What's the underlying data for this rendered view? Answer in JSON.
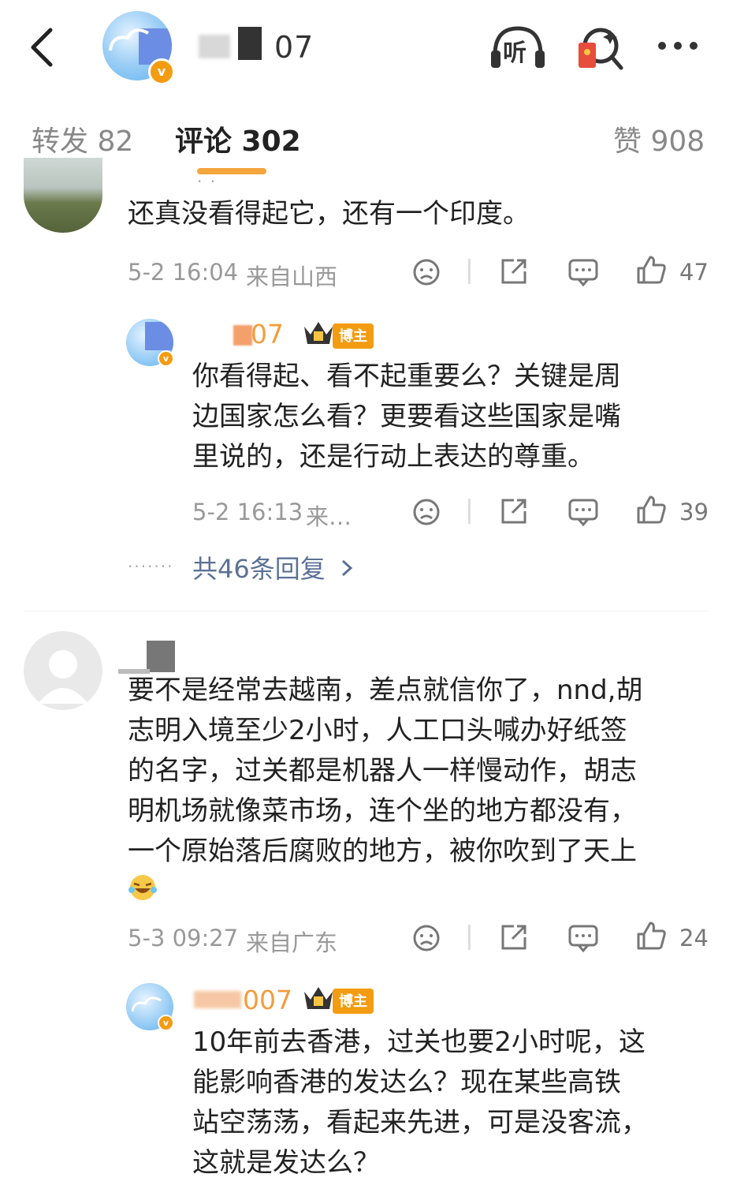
{
  "header": {
    "name_visible": "07",
    "listen_label": "听"
  },
  "tabs": [
    {
      "label": "转发 82"
    },
    {
      "label": "评论 302"
    },
    {
      "label": "赞 908"
    }
  ],
  "comments": [
    {
      "text": "还真没看得起它，还有一个印度。",
      "time": "5-2 16:04",
      "location": "来自山西",
      "likes": "47",
      "reply": {
        "name": "07",
        "badge": "博主",
        "text_lines": [
          "你看得起、看不起重要么？关键是周",
          "边国家怎么看？更要看这些国家是嘴",
          "里说的，还是行动上表达的尊重。"
        ],
        "time": "5-2 16:13",
        "location": "来…",
        "likes": "39"
      },
      "more_replies": "共46条回复"
    },
    {
      "text_lines": [
        "要不是经常去越南，差点就信你了，nnd,胡",
        "志明入境至少2小时，人工口头喊办好纸签",
        "的名字，过关都是机器人一样慢动作，胡志",
        "明机场就像菜市场，连个坐的地方都没有，",
        "一个原始落后腐败的地方，被你吹到了天上"
      ],
      "time": "5-3 09:27",
      "location": "来自广东",
      "likes": "24",
      "reply": {
        "name": "007",
        "badge": "博主",
        "text_lines": [
          "10年前去香港，过关也要2小时呢，这",
          "能影响香港的发达么？现在某些高铁",
          "站空荡荡，看起来先进，可是没客流，",
          "这就是发达么？"
        ]
      }
    }
  ],
  "colors": {
    "accent": "#f5a53c",
    "link": "#5b7196",
    "badge": "#f39c12"
  }
}
